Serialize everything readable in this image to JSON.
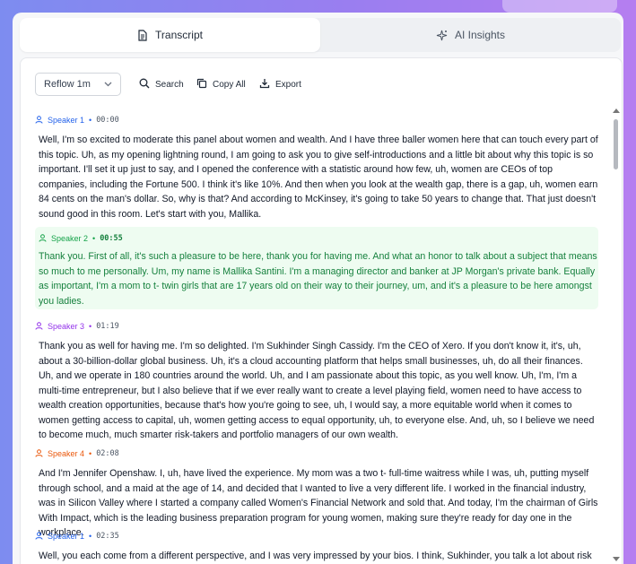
{
  "tabs": [
    {
      "label": "Transcript",
      "icon": "document-icon",
      "active": true
    },
    {
      "label": "AI Insights",
      "icon": "sparkle-icon",
      "active": false
    }
  ],
  "toolbar": {
    "reflow_value": "Reflow 1m",
    "search_label": "Search",
    "copy_label": "Copy All",
    "export_label": "Export"
  },
  "colors": {
    "speaker1": "#2563eb",
    "speaker2": "#16a34a",
    "speaker3": "#9333ea",
    "speaker4": "#ea580c",
    "highlight_bg": "#eefcf1",
    "highlight_text": "#15803d"
  },
  "entries": [
    {
      "speaker": "Speaker 1",
      "time": "00:00",
      "text": "Well, I'm so excited to moderate this panel about women and wealth. And I have three baller women here that can touch every part of this topic. Uh, as my opening lightning round, I am going to ask you to give self-introductions and a little bit about why this topic is so important. I'll set it up just to say, and I opened the conference with a statistic around how few, uh, women are CEOs of top companies, including the Fortune 500. I think it's like 10%. And then when you look at the wealth gap, there is a gap, uh, women earn 84 cents on the man's dollar. So, why is that? And according to McKinsey, it's going to take 50 years to change that. That just doesn't sound good in this room. Let's start with you, Mallika."
    },
    {
      "speaker": "Speaker 2",
      "time": "00:55",
      "text": "Thank you. First of all, it's such a pleasure to be here, thank you for having me. And what an honor to talk about a subject that means so much to me personally. Um, my name is Mallika Santini. I'm a managing director and banker at JP Morgan's private bank. Equally as important, I'm a mom to t- twin girls that are 17 years old on their way to their journey, um, and it's a pleasure to be here amongst you ladies."
    },
    {
      "speaker": "Speaker 3",
      "time": "01:19",
      "text": "Thank you as well for having me. I'm so delighted. I'm Sukhinder Singh Cassidy. I'm the CEO of Xero. If you don't know it, it's, uh, about a 30-billion-dollar global business. Uh, it's a cloud accounting platform that helps small businesses, uh, do all their finances. Uh, and we operate in 180 countries around the world. Uh, and I am passionate about this topic, as you well know. Uh, I'm, I'm a multi-time entrepreneur, but I also believe that if we ever really want to create a level playing field, women need to have access to wealth creation opportunities, because that's how you're going to see, uh, I would say, a more equitable world when it comes to women getting access to capital, uh, women getting access to equal opportunity, uh, to everyone else. And, uh, so I believe we need to become much, much smarter risk-takers and portfolio managers of our own wealth."
    },
    {
      "speaker": "Speaker 4",
      "time": "02:08",
      "text": "And I'm Jennifer Openshaw. I, uh, have lived the experience. My mom was a two t- full-time waitress while I was, uh, putting myself through school, and a maid at the age of 14, and decided that I wanted to live a very different life. I worked in the financial industry, was in Silicon Valley where I started a company called Women's Financial Network and sold that. And today, I'm the chairman of Girls With Impact, which is the leading business preparation program for young women, making sure they're ready for day one in the workplace."
    },
    {
      "speaker": "Speaker 1",
      "time": "02:35",
      "text": "Well, you each come from a different perspective, and I was very impressed by your bios. I think, Sukhinder, you talk a lot about risk and"
    }
  ]
}
